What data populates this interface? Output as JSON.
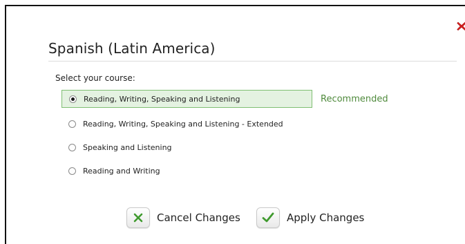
{
  "dialog": {
    "title": "Spanish (Latin America)",
    "close_icon": "close-x-icon",
    "section_label": "Select your course:",
    "options": [
      {
        "label": "Reading, Writing, Speaking and Listening",
        "selected": true
      },
      {
        "label": "Reading, Writing, Speaking and Listening - Extended",
        "selected": false
      },
      {
        "label": "Speaking and Listening",
        "selected": false
      },
      {
        "label": "Reading and Writing",
        "selected": false
      }
    ],
    "recommended_label": "Recommended",
    "cancel_label": "Cancel Changes",
    "apply_label": "Apply Changes"
  },
  "colors": {
    "accent_green": "#4f8a3c",
    "selected_bg": "#e4f2e1",
    "close_red": "#d21f1f"
  }
}
